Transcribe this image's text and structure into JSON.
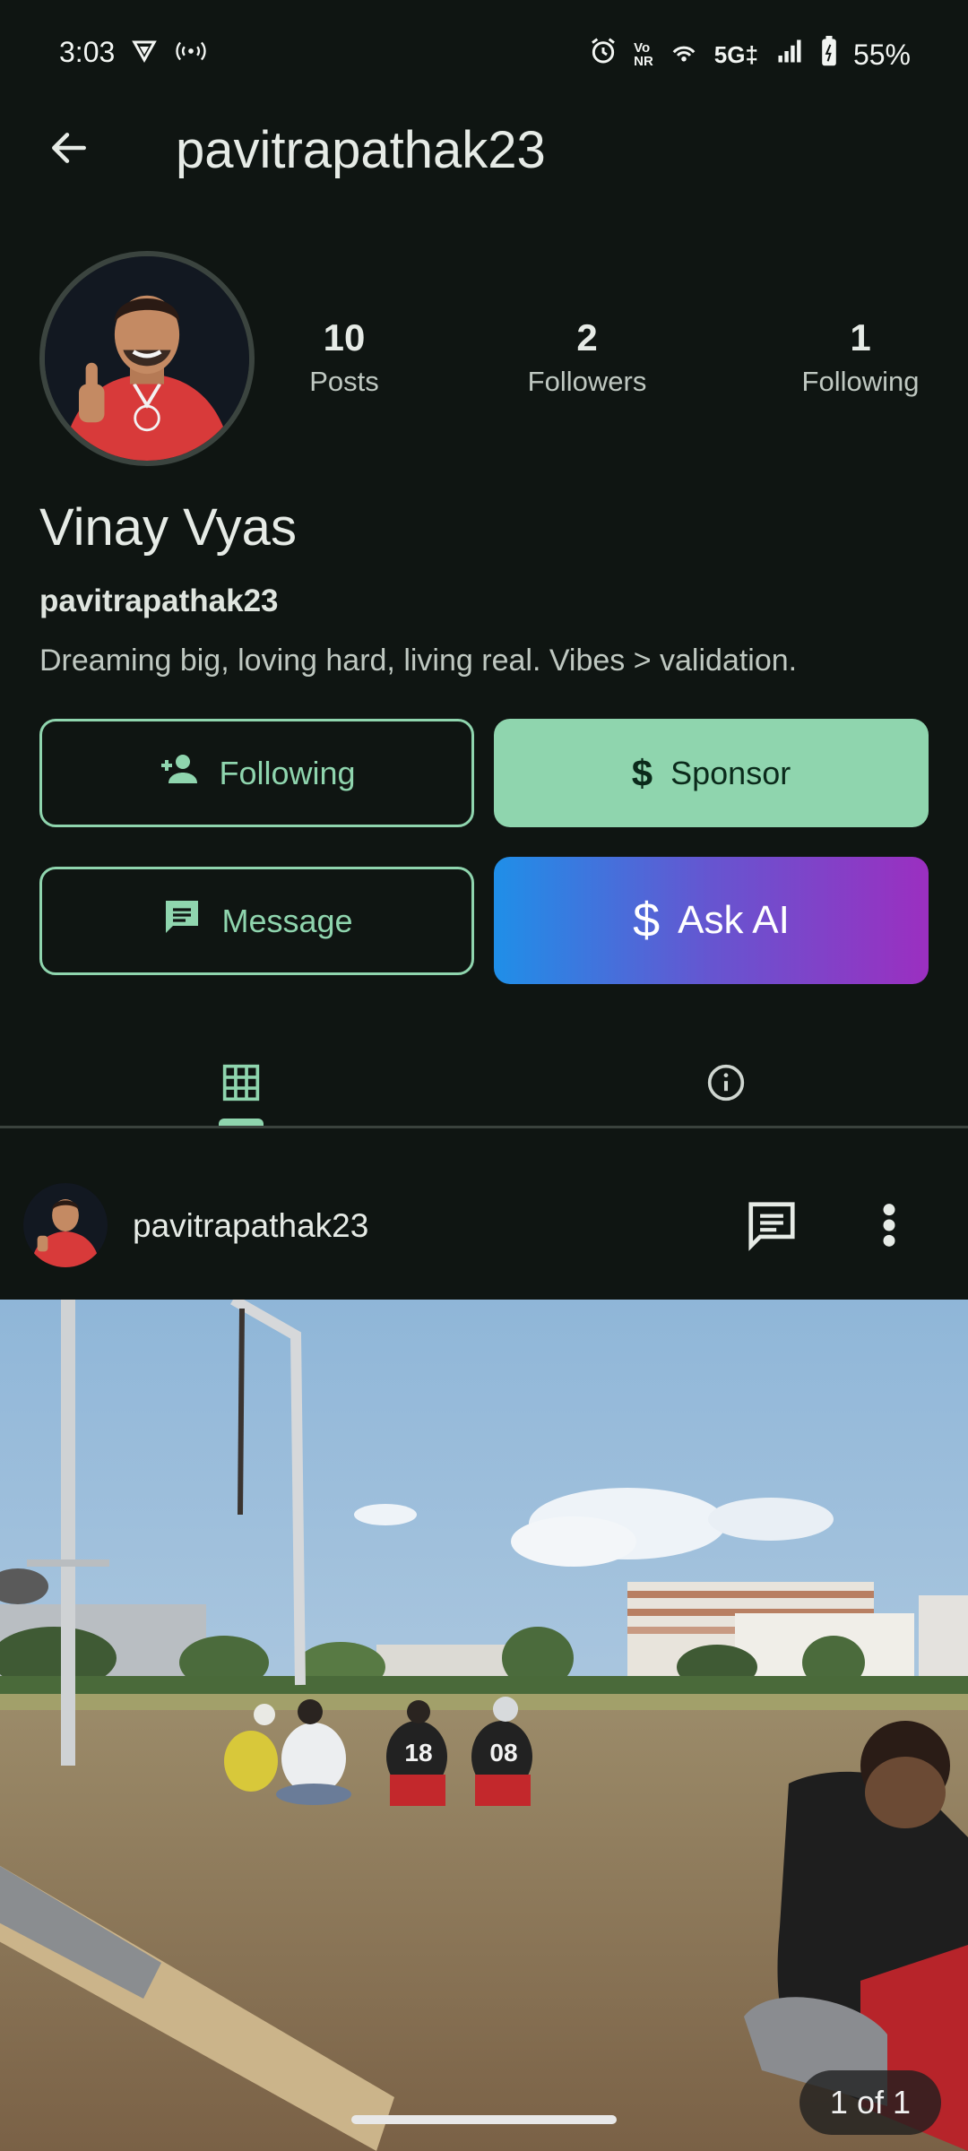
{
  "status_bar": {
    "time": "3:03",
    "network": "5G‡",
    "battery": "55%",
    "volte_label_top": "Vo",
    "volte_label_bottom": "NR"
  },
  "header": {
    "title": "pavitrapathak23"
  },
  "profile": {
    "stats": [
      {
        "value": "10",
        "label": "Posts"
      },
      {
        "value": "2",
        "label": "Followers"
      },
      {
        "value": "1",
        "label": "Following"
      }
    ],
    "name": "Vinay Vyas",
    "username": "pavitrapathak23",
    "bio": "Dreaming big, loving hard, living real. Vibes > validation."
  },
  "actions": {
    "following_label": "Following",
    "sponsor_label": "Sponsor",
    "message_label": "Message",
    "ask_ai_label": "Ask AI"
  },
  "tabs": {
    "grid_icon": "grid-icon",
    "info_icon": "info-icon"
  },
  "post": {
    "username": "pavitrapathak23",
    "counter": "1 of 1",
    "jersey_numbers": [
      "18",
      "08"
    ]
  },
  "colors": {
    "background": "#0f1512",
    "accent": "#8fd5ae",
    "ai_gradient_start": "#1f8fe8",
    "ai_gradient_end": "#9b2fc0"
  }
}
